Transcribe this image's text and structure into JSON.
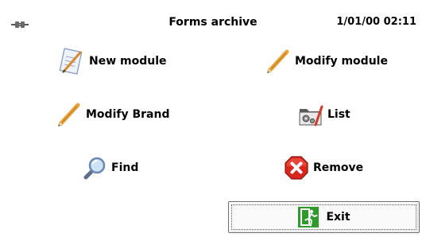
{
  "header": {
    "title": "Forms archive",
    "datetime": "1/01/00 02:11",
    "connection_icon": "plug-connection-icon"
  },
  "menu": {
    "new_module": {
      "label": "New module",
      "icon": "form-edit-icon"
    },
    "modify_module": {
      "label": "Modify module",
      "icon": "pencil-icon"
    },
    "modify_brand": {
      "label": "Modify Brand",
      "icon": "pencil-icon"
    },
    "list": {
      "label": "List",
      "icon": "folder-gear-icon"
    },
    "find": {
      "label": "Find",
      "icon": "magnifier-icon"
    },
    "remove": {
      "label": "Remove",
      "icon": "red-x-icon"
    }
  },
  "exit": {
    "label": "Exit",
    "icon": "exit-door-icon"
  },
  "colors": {
    "remove_red": "#d9261c",
    "exit_green": "#2f9a2a",
    "pencil_orange": "#e8a33a"
  }
}
